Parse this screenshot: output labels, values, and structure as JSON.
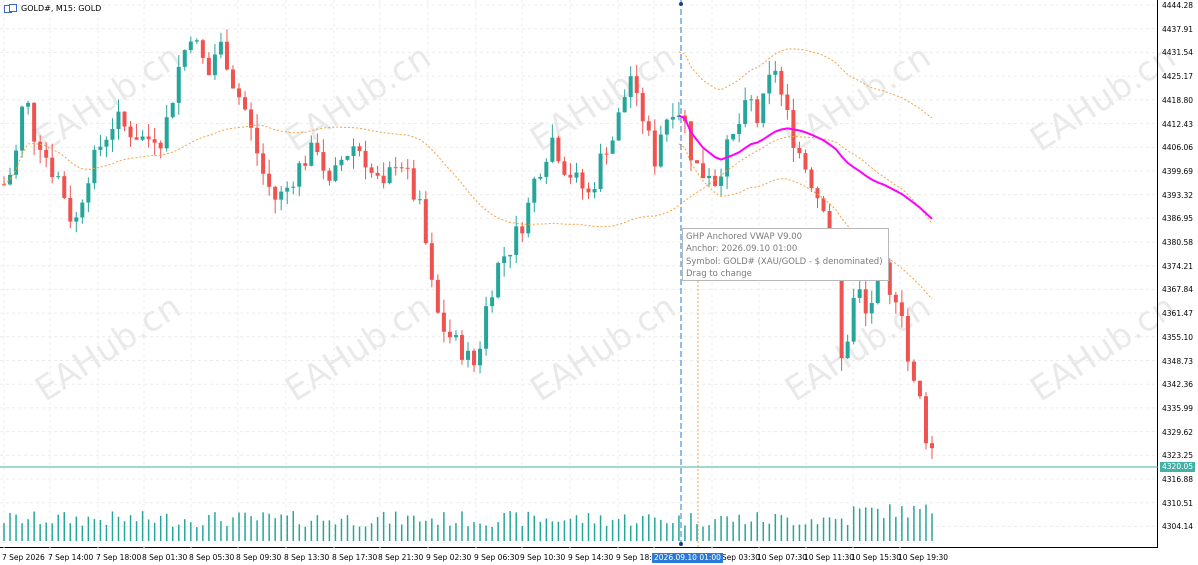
{
  "header": {
    "symbol_title": "GOLD#, M15:  GOLD"
  },
  "price_axis": {
    "labels": [
      "4444.28",
      "4437.91",
      "4431.54",
      "4425.17",
      "4418.80",
      "4412.43",
      "4406.06",
      "4399.69",
      "4393.32",
      "4386.95",
      "4380.58",
      "4374.21",
      "4367.84",
      "4361.47",
      "4355.10",
      "4348.73",
      "4342.36",
      "4335.99",
      "4329.62",
      "4323.25",
      "4316.88",
      "4310.51",
      "4304.14"
    ],
    "current_price": "4320.05"
  },
  "time_axis": {
    "labels": [
      "7 Sep 2026",
      "7 Sep 14:00",
      "7 Sep 18:00",
      "8 Sep 01:30",
      "8 Sep 05:30",
      "8 Sep 09:30",
      "8 Sep 13:30",
      "8 Sep 17:30",
      "8 Sep 21:30",
      "9 Sep 02:30",
      "9 Sep 06:30",
      "9 Sep 10:30",
      "9 Sep 14:30",
      "9 Sep 18:30",
      "2026.09.10 01:00",
      "10 Sep 03:30",
      "10 Sep 07:30",
      "10 Sep 11:30",
      "10 Sep 15:30",
      "10 Sep 19:30"
    ],
    "crosshair_time": "2026.09.10 01:00"
  },
  "tooltip": {
    "line1": "GHP Anchored VWAP V9.00",
    "line2": "Anchor: 2026.09.10 01:00",
    "line3": "Symbol: GOLD# (XAU/GOLD - $ denominated)",
    "line4": "Drag to change"
  },
  "watermark": "EAHub.cn",
  "colors": {
    "bull": "#26a69a",
    "bear": "#ef5350",
    "vwap": "#ff00ff",
    "bands": "#f4a340",
    "current_line": "#45b0a5",
    "crosshair": "#2a7ad6"
  },
  "chart_data": {
    "type": "candlestick",
    "symbol": "GOLD#",
    "timeframe": "M15",
    "ylim": [
      4300,
      4446
    ],
    "close_path": [
      4395,
      4398,
      4404,
      4416,
      4417,
      4409,
      4407,
      4403,
      4399,
      4397,
      4392,
      4386,
      4385,
      4392,
      4398,
      4402,
      4406,
      4409,
      4412,
      4413,
      4411,
      4410,
      4409,
      4408,
      4408,
      4409,
      4408,
      4413,
      4420,
      4428,
      4433,
      4438,
      4434,
      4430,
      4426,
      4432,
      4434,
      4430,
      4424,
      4420,
      4416,
      4410,
      4404,
      4398,
      4394,
      4391,
      4392,
      4394,
      4397,
      4400,
      4402,
      4404,
      4406,
      4400,
      4394,
      4398,
      4402,
      4404,
      4406,
      4405,
      4402,
      4398,
      4396,
      4393,
      4398,
      4402,
      4401,
      4397,
      4392,
      4388,
      4378,
      4366,
      4358,
      4354,
      4352,
      4350,
      4348,
      4346,
      4344,
      4350,
      4360,
      4366,
      4372,
      4375,
      4377,
      4381,
      4384,
      4389,
      4396,
      4400,
      4404,
      4408,
      4404,
      4400,
      4398,
      4396,
      4394,
      4392,
      4396,
      4402,
      4406,
      4408,
      4414,
      4420,
      4426,
      4418,
      4414,
      4408,
      4402,
      4410,
      4414,
      4417,
      4416,
      4412,
      4404,
      4400,
      4398,
      4399,
      4396,
      4400,
      4405,
      4408,
      4412,
      4416,
      4418,
      4413,
      4418,
      4424,
      4428,
      4420,
      4414,
      4408,
      4404,
      4400,
      4396,
      4392,
      4390,
      4378,
      4370,
      4345,
      4352,
      4362,
      4364,
      4358,
      4362,
      4366,
      4370,
      4362,
      4364,
      4360,
      4345,
      4338,
      4334,
      4324,
      4320
    ]
  }
}
